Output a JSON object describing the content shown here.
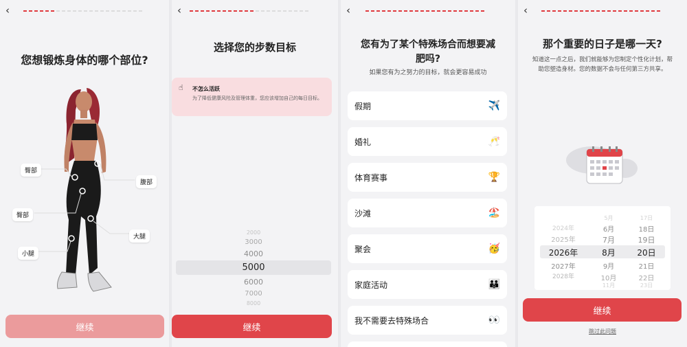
{
  "colors": {
    "accent": "#e0393e",
    "button_faded": "#eb9b9c",
    "button_solid": "#e0454a",
    "panel_bg": "#f3f3f5",
    "card_pink": "#f9dde0"
  },
  "common": {
    "back_icon": "chevron-left-icon",
    "back_glyph": "‹"
  },
  "screen1": {
    "title": "您想锻炼身体的哪个部位?",
    "labels": {
      "hip": "臀部",
      "waist": "腹部",
      "butt": "臀部",
      "thigh": "大腿",
      "calf": "小腿"
    },
    "button_label": "继续",
    "progress": {
      "done": 6,
      "total": 22
    }
  },
  "screen2": {
    "title": "选择您的步数目标",
    "card": {
      "icon": "☝",
      "title": "不怎么活跃",
      "description": "为了降低健康风险及管理体重，您应该增加自己的每日目标。"
    },
    "picker": {
      "above": [
        "2000",
        "3000",
        "4000"
      ],
      "selected": "5000",
      "below": [
        "6000",
        "7000",
        "8000"
      ]
    },
    "button_label": "继续",
    "progress": {
      "done": 12,
      "total": 22
    }
  },
  "screen3": {
    "title_line1": "您有为了某个特殊场合而想要减",
    "title_line2": "肥吗?",
    "subtitle": "如果您有为之努力的目标，就会更容易成功",
    "options": [
      {
        "label": "假期",
        "icon": "airplane-icon",
        "emoji": "✈️"
      },
      {
        "label": "婚礼",
        "icon": "champagne-glasses-icon",
        "emoji": "🥂"
      },
      {
        "label": "体育赛事",
        "icon": "trophy-icon",
        "emoji": "🏆"
      },
      {
        "label": "沙滩",
        "icon": "beach-umbrella-icon",
        "emoji": "🏖️"
      },
      {
        "label": "聚会",
        "icon": "party-face-icon",
        "emoji": "🥳"
      },
      {
        "label": "家庭活动",
        "icon": "family-icon",
        "emoji": "👪"
      },
      {
        "label": "我不需要去特殊场合",
        "icon": "eyes-icon",
        "emoji": "👀"
      }
    ],
    "progress": {
      "done": 22,
      "total": 22
    }
  },
  "screen4": {
    "title": "那个重要的日子是哪一天?",
    "subtitle_line1": "知道这一点之后，我们就能够为您制定个性化计划，帮",
    "subtitle_line2": "助您塑造身材。您的数据不会与任何第三方共享。",
    "calendar_icon": "calendar-icon",
    "years": [
      "2024年",
      "2025年",
      "2026年",
      "2027年",
      "2028年"
    ],
    "months": [
      "5月",
      "6月",
      "7月",
      "8月",
      "9月",
      "10月",
      "11月"
    ],
    "days": [
      "17日",
      "18日",
      "19日",
      "20日",
      "21日",
      "22日",
      "23日"
    ],
    "selected": {
      "year": "2026年",
      "month": "8月",
      "day": "20日"
    },
    "button_label": "继续",
    "skip_label": "跳过此问题",
    "progress": {
      "done": 22,
      "total": 22
    }
  }
}
